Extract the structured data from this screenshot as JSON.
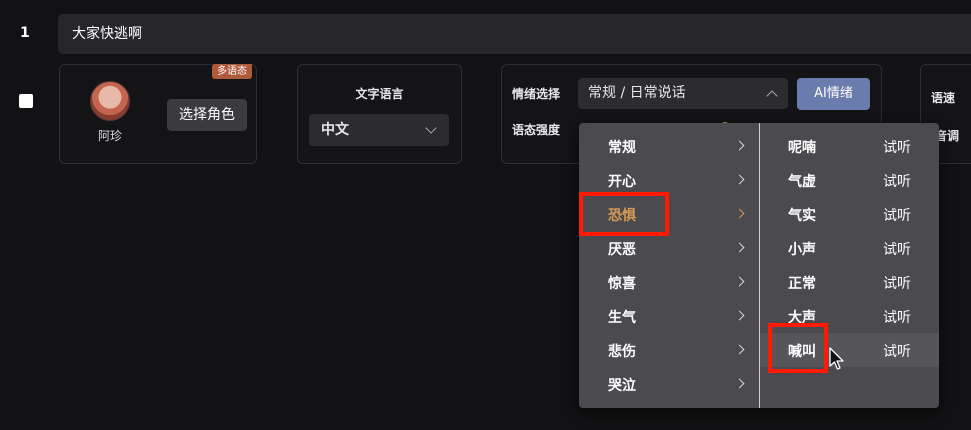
{
  "row": {
    "index": "1",
    "text": "大家快逃啊"
  },
  "character": {
    "badge": "多语态",
    "name": "阿珍",
    "pick_button": "选择角色"
  },
  "language": {
    "title": "文字语言",
    "selected": "中文"
  },
  "emotion": {
    "label": "情绪选择",
    "selected": "常规 / 日常说话",
    "ai_button": "AI情绪",
    "strength_label": "语态强度"
  },
  "speed": {
    "label": "语速",
    "pitch_label": "音调"
  },
  "menu": {
    "categories": [
      {
        "label": "常规"
      },
      {
        "label": "开心"
      },
      {
        "label": "恐惧"
      },
      {
        "label": "厌恶"
      },
      {
        "label": "惊喜"
      },
      {
        "label": "生气"
      },
      {
        "label": "悲伤"
      },
      {
        "label": "哭泣"
      }
    ],
    "active_category": "恐惧",
    "sub_items": [
      {
        "label": "呢喃",
        "action": "试听"
      },
      {
        "label": "气虚",
        "action": "试听"
      },
      {
        "label": "气实",
        "action": "试听"
      },
      {
        "label": "小声",
        "action": "试听"
      },
      {
        "label": "正常",
        "action": "试听"
      },
      {
        "label": "大声",
        "action": "试听"
      },
      {
        "label": "喊叫",
        "action": "试听"
      }
    ],
    "hovered_sub_item": "喊叫"
  },
  "colors": {
    "accent_active": "#d49a52",
    "ai_button": "#6a7cad",
    "highlight_box": "#ff1a00",
    "badge": "#b05a3c"
  }
}
